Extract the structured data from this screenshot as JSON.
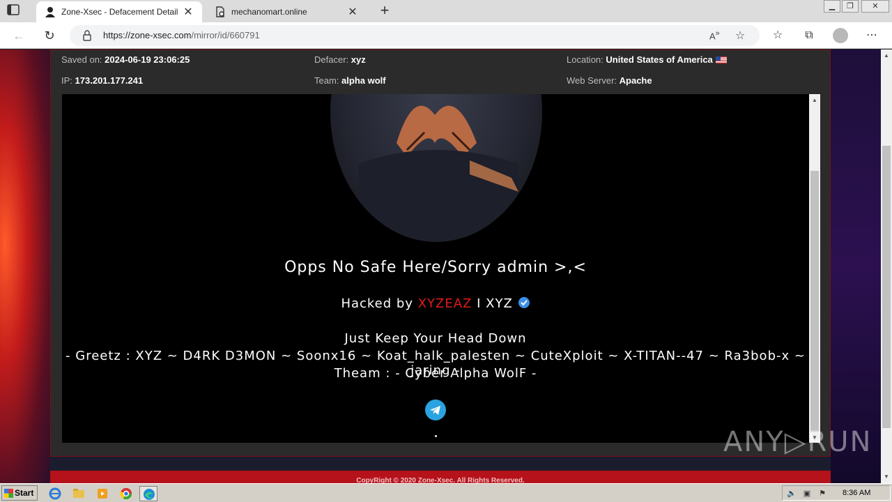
{
  "browser": {
    "tabs": [
      {
        "title": "Zone-Xsec - Defacement Detail"
      },
      {
        "title": "mechanomart.online"
      }
    ],
    "url_host": "https://zone-xsec.com",
    "url_path": "/mirror/id/660791",
    "window_controls": [
      "minimize",
      "restore",
      "close"
    ]
  },
  "details": {
    "saved_on_label": "Saved on:",
    "saved_on": "2024-06-19 23:06:25",
    "defacer_label": "Defacer:",
    "defacer": "xyz",
    "location_label": "Location:",
    "location": "United States of America",
    "ip_label": "IP:",
    "ip": "173.201.177.241",
    "team_label": "Team:",
    "team": "alpha wolf",
    "server_label": "Web Server:",
    "server": "Apache"
  },
  "deface": {
    "headline": "Opps No Safe Here/Sorry admin >,<",
    "hacked_prefix": "Hacked by ",
    "hacked_name": "XYZEAZ",
    "hacked_suffix": " I XYZ",
    "tagline": "Just Keep Your Head Down",
    "greetz": "- Greetz : XYZ ~ D4RK D3MON ~ Soonx16 ~ Koat_halk_palesten ~ CuteXploit ~ X-TITAN--47 ~ Ra3bob-x ~ jaring -",
    "team_line": "Theam : - Cyber Alpha WolF -"
  },
  "footer": {
    "text": "CopyRight © 2020 Zone-Xsec. All Rights Reserved."
  },
  "watermark": "ANY▷RUN",
  "taskbar": {
    "start_label": "Start",
    "apps": [
      "ie-icon",
      "explorer-icon",
      "media-icon",
      "chrome-icon",
      "edge-icon"
    ],
    "clock": "8:36 AM"
  },
  "colors": {
    "accent_red": "#e01b1b",
    "footer_red": "#b5121b",
    "telegram": "#2aa3e0"
  }
}
